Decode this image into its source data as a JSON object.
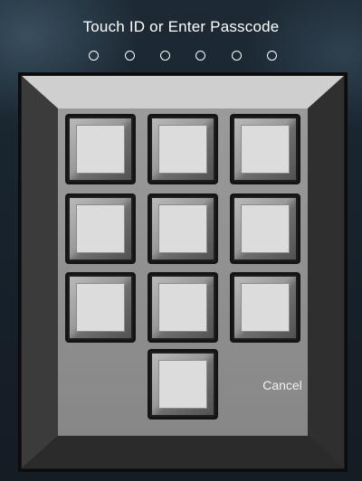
{
  "header": {
    "title": "Touch ID or Enter Passcode"
  },
  "passcode": {
    "length": 6,
    "entered": 0
  },
  "keypad": {
    "keys": [
      {
        "id": "key-1"
      },
      {
        "id": "key-2"
      },
      {
        "id": "key-3"
      },
      {
        "id": "key-4"
      },
      {
        "id": "key-5"
      },
      {
        "id": "key-6"
      },
      {
        "id": "key-7"
      },
      {
        "id": "key-8"
      },
      {
        "id": "key-9"
      },
      {
        "id": "key-0"
      }
    ],
    "cancel_label": "Cancel"
  },
  "colors": {
    "key_face": "#dcdcdc",
    "frame_light": "#c9c9c9",
    "frame_dark": "#1b1b1b",
    "text": "#ffffff"
  }
}
